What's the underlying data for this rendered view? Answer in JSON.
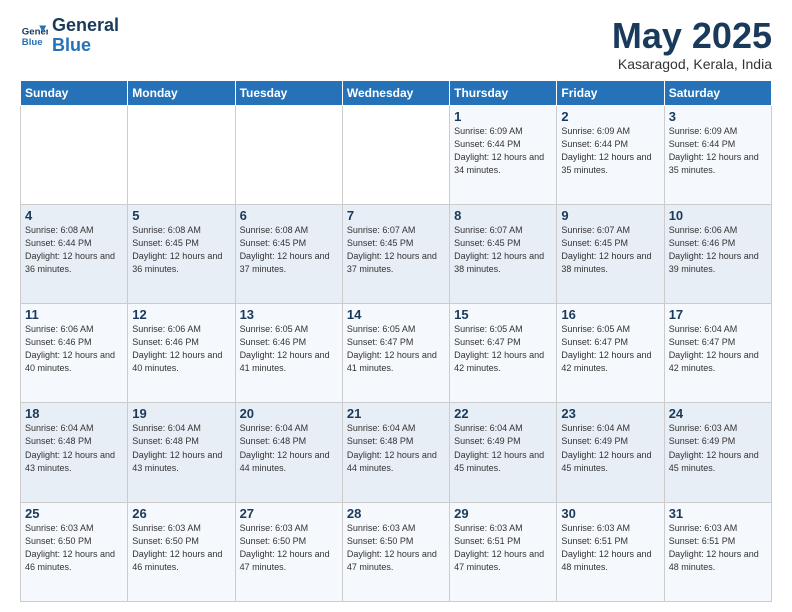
{
  "logo": {
    "line1": "General",
    "line2": "Blue"
  },
  "header": {
    "month": "May 2025",
    "location": "Kasaragod, Kerala, India"
  },
  "weekdays": [
    "Sunday",
    "Monday",
    "Tuesday",
    "Wednesday",
    "Thursday",
    "Friday",
    "Saturday"
  ],
  "weeks": [
    [
      {
        "day": "",
        "info": ""
      },
      {
        "day": "",
        "info": ""
      },
      {
        "day": "",
        "info": ""
      },
      {
        "day": "",
        "info": ""
      },
      {
        "day": "1",
        "info": "Sunrise: 6:09 AM\nSunset: 6:44 PM\nDaylight: 12 hours\nand 34 minutes."
      },
      {
        "day": "2",
        "info": "Sunrise: 6:09 AM\nSunset: 6:44 PM\nDaylight: 12 hours\nand 35 minutes."
      },
      {
        "day": "3",
        "info": "Sunrise: 6:09 AM\nSunset: 6:44 PM\nDaylight: 12 hours\nand 35 minutes."
      }
    ],
    [
      {
        "day": "4",
        "info": "Sunrise: 6:08 AM\nSunset: 6:44 PM\nDaylight: 12 hours\nand 36 minutes."
      },
      {
        "day": "5",
        "info": "Sunrise: 6:08 AM\nSunset: 6:45 PM\nDaylight: 12 hours\nand 36 minutes."
      },
      {
        "day": "6",
        "info": "Sunrise: 6:08 AM\nSunset: 6:45 PM\nDaylight: 12 hours\nand 37 minutes."
      },
      {
        "day": "7",
        "info": "Sunrise: 6:07 AM\nSunset: 6:45 PM\nDaylight: 12 hours\nand 37 minutes."
      },
      {
        "day": "8",
        "info": "Sunrise: 6:07 AM\nSunset: 6:45 PM\nDaylight: 12 hours\nand 38 minutes."
      },
      {
        "day": "9",
        "info": "Sunrise: 6:07 AM\nSunset: 6:45 PM\nDaylight: 12 hours\nand 38 minutes."
      },
      {
        "day": "10",
        "info": "Sunrise: 6:06 AM\nSunset: 6:46 PM\nDaylight: 12 hours\nand 39 minutes."
      }
    ],
    [
      {
        "day": "11",
        "info": "Sunrise: 6:06 AM\nSunset: 6:46 PM\nDaylight: 12 hours\nand 40 minutes."
      },
      {
        "day": "12",
        "info": "Sunrise: 6:06 AM\nSunset: 6:46 PM\nDaylight: 12 hours\nand 40 minutes."
      },
      {
        "day": "13",
        "info": "Sunrise: 6:05 AM\nSunset: 6:46 PM\nDaylight: 12 hours\nand 41 minutes."
      },
      {
        "day": "14",
        "info": "Sunrise: 6:05 AM\nSunset: 6:47 PM\nDaylight: 12 hours\nand 41 minutes."
      },
      {
        "day": "15",
        "info": "Sunrise: 6:05 AM\nSunset: 6:47 PM\nDaylight: 12 hours\nand 42 minutes."
      },
      {
        "day": "16",
        "info": "Sunrise: 6:05 AM\nSunset: 6:47 PM\nDaylight: 12 hours\nand 42 minutes."
      },
      {
        "day": "17",
        "info": "Sunrise: 6:04 AM\nSunset: 6:47 PM\nDaylight: 12 hours\nand 42 minutes."
      }
    ],
    [
      {
        "day": "18",
        "info": "Sunrise: 6:04 AM\nSunset: 6:48 PM\nDaylight: 12 hours\nand 43 minutes."
      },
      {
        "day": "19",
        "info": "Sunrise: 6:04 AM\nSunset: 6:48 PM\nDaylight: 12 hours\nand 43 minutes."
      },
      {
        "day": "20",
        "info": "Sunrise: 6:04 AM\nSunset: 6:48 PM\nDaylight: 12 hours\nand 44 minutes."
      },
      {
        "day": "21",
        "info": "Sunrise: 6:04 AM\nSunset: 6:48 PM\nDaylight: 12 hours\nand 44 minutes."
      },
      {
        "day": "22",
        "info": "Sunrise: 6:04 AM\nSunset: 6:49 PM\nDaylight: 12 hours\nand 45 minutes."
      },
      {
        "day": "23",
        "info": "Sunrise: 6:04 AM\nSunset: 6:49 PM\nDaylight: 12 hours\nand 45 minutes."
      },
      {
        "day": "24",
        "info": "Sunrise: 6:03 AM\nSunset: 6:49 PM\nDaylight: 12 hours\nand 45 minutes."
      }
    ],
    [
      {
        "day": "25",
        "info": "Sunrise: 6:03 AM\nSunset: 6:50 PM\nDaylight: 12 hours\nand 46 minutes."
      },
      {
        "day": "26",
        "info": "Sunrise: 6:03 AM\nSunset: 6:50 PM\nDaylight: 12 hours\nand 46 minutes."
      },
      {
        "day": "27",
        "info": "Sunrise: 6:03 AM\nSunset: 6:50 PM\nDaylight: 12 hours\nand 47 minutes."
      },
      {
        "day": "28",
        "info": "Sunrise: 6:03 AM\nSunset: 6:50 PM\nDaylight: 12 hours\nand 47 minutes."
      },
      {
        "day": "29",
        "info": "Sunrise: 6:03 AM\nSunset: 6:51 PM\nDaylight: 12 hours\nand 47 minutes."
      },
      {
        "day": "30",
        "info": "Sunrise: 6:03 AM\nSunset: 6:51 PM\nDaylight: 12 hours\nand 48 minutes."
      },
      {
        "day": "31",
        "info": "Sunrise: 6:03 AM\nSunset: 6:51 PM\nDaylight: 12 hours\nand 48 minutes."
      }
    ]
  ]
}
